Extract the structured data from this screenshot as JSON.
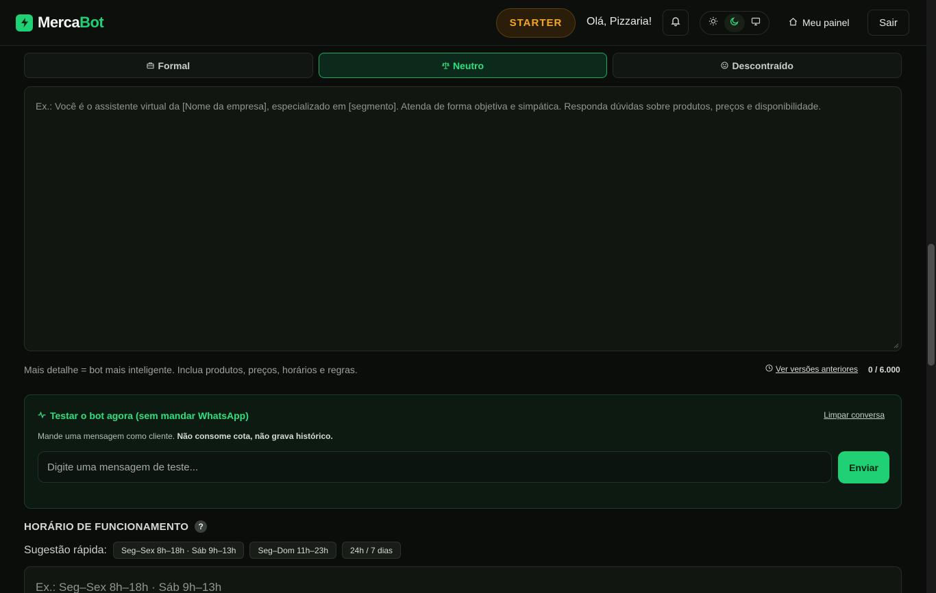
{
  "header": {
    "logo_part1": "Merca",
    "logo_part2": "Bot",
    "plan_badge": "STARTER",
    "greeting": "Olá, Pizzaria!",
    "panel_link": "Meu painel",
    "logout": "Sair",
    "theme_options": [
      "sun-icon",
      "moon-icon",
      "monitor-icon"
    ],
    "theme_selected": "dark"
  },
  "tone": {
    "options": [
      {
        "label": "Formal",
        "icon": "briefcase-icon"
      },
      {
        "label": "Neutro",
        "icon": "scale-icon"
      },
      {
        "label": "Descontraído",
        "icon": "smile-icon"
      }
    ],
    "selected": "Neutro"
  },
  "prompt": {
    "placeholder": "Ex.: Você é o assistente virtual da [Nome da empresa], especializado em [segmento]. Atenda de forma objetiva e simpática. Responda dúvidas sobre produtos, preços e disponibilidade.",
    "helper": "Mais detalhe = bot mais inteligente. Inclua produtos, preços, horários e regras.",
    "versions_link": "Ver versões anteriores",
    "counter": "0 / 6.000"
  },
  "test": {
    "title": "Testar o bot agora (sem mandar WhatsApp)",
    "clear_link": "Limpar conversa",
    "desc_plain": "Mande uma mensagem como cliente.",
    "desc_bold": "Não consome cota, não grava histórico.",
    "input_placeholder": "Digite uma mensagem de teste...",
    "send_label": "Enviar"
  },
  "hours": {
    "title": "HORÁRIO DE FUNCIONAMENTO",
    "help": "?",
    "quick_label": "Sugestão rápida:",
    "suggestions": [
      "Seg–Sex 8h–18h · Sáb 9h–13h",
      "Seg–Dom 11h–23h",
      "24h / 7 dias"
    ],
    "placeholder": "Ex.: Seg–Sex 8h–18h · Sáb 9h–13h"
  },
  "colors": {
    "accent": "#1fd174",
    "plan": "#f5a623",
    "background": "#0b0d0b"
  }
}
